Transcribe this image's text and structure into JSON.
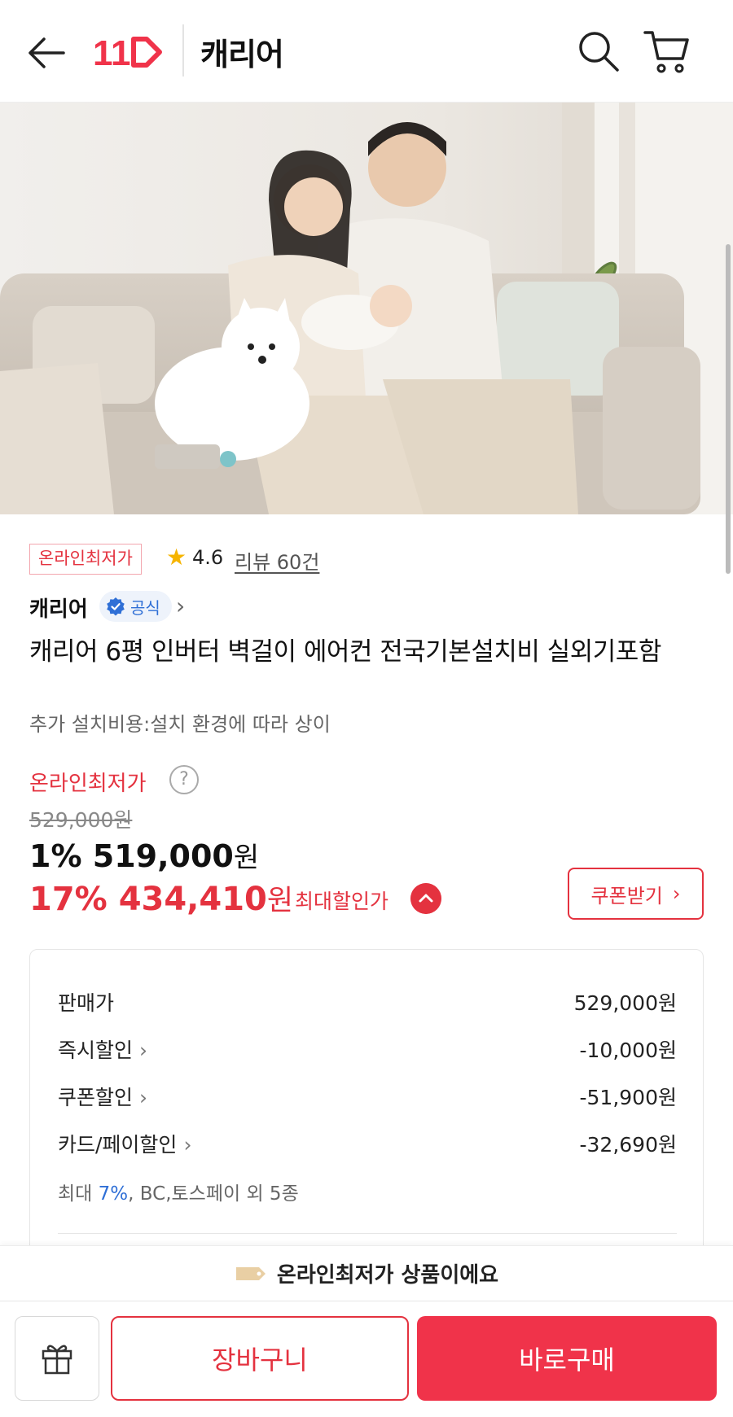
{
  "header": {
    "title": "캐리어",
    "logo_text": "11"
  },
  "product": {
    "badge": "온라인최저가",
    "rating": "4.6",
    "review_link": "리뷰 60건",
    "brand": "캐리어",
    "official_label": "공식",
    "title": "캐리어 6평 인버터 벽걸이 에어컨 전국기본설치비 실외기포함",
    "subtitle": "추가 설치비용:설치 환경에 따라 상이"
  },
  "price": {
    "label": "온라인최저가",
    "help": "?",
    "original": "529,000원",
    "sale_pct": "1%",
    "sale_amount": "519,000",
    "max_pct": "17%",
    "max_amount": "434,410",
    "won": "원",
    "max_label": "최대할인가",
    "coupon_button": "쿠폰받기"
  },
  "breakdown": {
    "rows": [
      {
        "label": "판매가",
        "value": "529,000원"
      },
      {
        "label": "즉시할인",
        "value": "-10,000원"
      },
      {
        "label": "쿠폰할인",
        "value": "-51,900원"
      },
      {
        "label": "카드/페이할인",
        "value": "-32,690원"
      }
    ],
    "note_prefix": "최대",
    "note_pct": "7%",
    "note_suffix": ", BC,토스페이 외 5종"
  },
  "notice": {
    "text": "온라인최저가 상품이에요"
  },
  "actions": {
    "cart": "장바구니",
    "buy": "바로구매"
  },
  "colors": {
    "accent": "#e4323f",
    "buy_button": "#f0334a",
    "official_blue": "#2f6fd6",
    "star": "#f6b400"
  },
  "icons": [
    "back-arrow-icon",
    "search-icon",
    "cart-icon",
    "star-icon",
    "verified-icon",
    "chevron-right-icon",
    "help-icon",
    "chevron-up-icon",
    "price-tag-icon",
    "gift-icon"
  ]
}
